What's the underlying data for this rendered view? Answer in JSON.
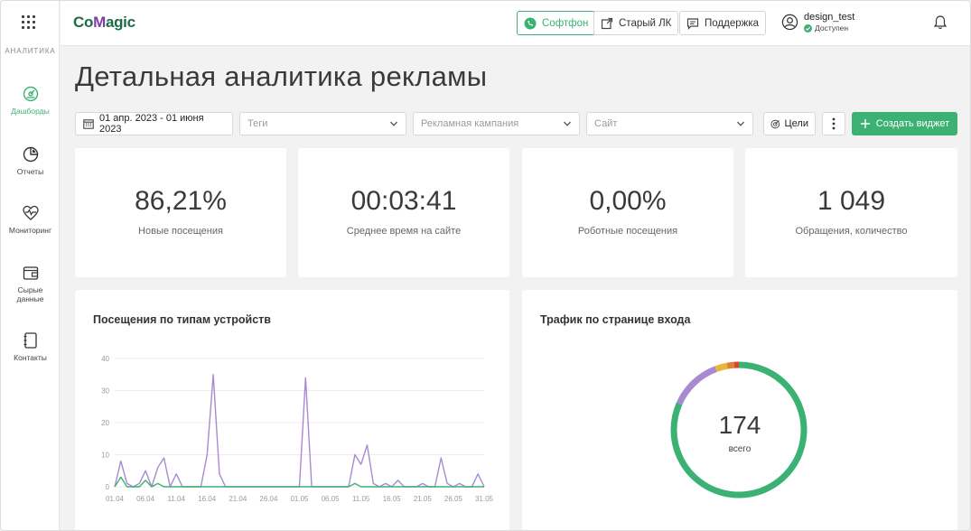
{
  "sidebar": {
    "section": "АНАЛИТИКА",
    "items": [
      {
        "label": "Дашборды",
        "icon": "dashboard-icon"
      },
      {
        "label": "Отчеты",
        "icon": "pie-chart-icon"
      },
      {
        "label": "Мониторинг",
        "icon": "heart-pulse-icon"
      },
      {
        "label": "Сырые данные",
        "icon": "wallet-icon"
      },
      {
        "label": "Контакты",
        "icon": "contacts-book-icon"
      }
    ]
  },
  "topbar": {
    "logo_a": "Co",
    "logo_b": "M",
    "logo_c": "agic",
    "softphone": "Софтфон",
    "old_lk": "Старый ЛК",
    "support": "Поддержка",
    "username": "design_test",
    "status": "Доступен"
  },
  "page": {
    "title": "Детальная аналитика рекламы"
  },
  "filters": {
    "date_range": "01 апр. 2023 - 01 июня 2023",
    "tags_placeholder": "Теги",
    "campaign_placeholder": "Рекламная кампания",
    "site_placeholder": "Сайт",
    "goals": "Цели",
    "create_widget": "Создать виджет"
  },
  "kpis": [
    {
      "value": "86,21%",
      "label": "Новые посещения"
    },
    {
      "value": "00:03:41",
      "label": "Среднее время на сайте"
    },
    {
      "value": "0,00%",
      "label": "Роботные посещения"
    },
    {
      "value": "1 049",
      "label": "Обращения, количество"
    }
  ],
  "colors": {
    "accent": "#3bb273",
    "purple": "#a98ad1",
    "orange": "#e8a33d",
    "red": "#d9452b"
  },
  "chart_data": [
    {
      "type": "line",
      "title": "Посещения по типам устройств",
      "x": [
        "01.04",
        "02.04",
        "03.04",
        "04.04",
        "05.04",
        "06.04",
        "07.04",
        "08.04",
        "09.04",
        "10.04",
        "11.04",
        "12.04",
        "13.04",
        "14.04",
        "15.04",
        "16.04",
        "17.04",
        "18.04",
        "19.04",
        "20.04",
        "21.04",
        "22.04",
        "23.04",
        "24.04",
        "25.04",
        "26.04",
        "27.04",
        "28.04",
        "29.04",
        "30.04",
        "01.05",
        "02.05",
        "03.05",
        "04.05",
        "05.05",
        "06.05",
        "07.05",
        "08.05",
        "09.05",
        "10.05",
        "11.05",
        "12.05",
        "13.05",
        "14.05",
        "15.05",
        "16.05",
        "17.05",
        "18.05",
        "19.05",
        "20.05",
        "21.05",
        "22.05",
        "23.05",
        "24.05",
        "25.05",
        "26.05",
        "27.05",
        "28.05",
        "29.05",
        "30.05",
        "31.05"
      ],
      "x_ticks": [
        "01.04",
        "06.04",
        "11.04",
        "16.04",
        "21.04",
        "26.04",
        "01.05",
        "06.05",
        "11.05",
        "16.05",
        "21.05",
        "26.05",
        "31.05"
      ],
      "y_ticks": [
        0,
        10,
        20,
        30,
        40
      ],
      "ylim": [
        0,
        40
      ],
      "grid": true,
      "series": [
        {
          "color": "#a98ad1",
          "values": [
            0,
            8,
            1,
            0,
            1,
            5,
            0,
            6,
            9,
            0,
            4,
            0,
            0,
            0,
            0,
            10,
            35,
            4,
            0,
            0,
            0,
            0,
            0,
            0,
            0,
            0,
            0,
            0,
            0,
            0,
            0,
            34,
            0,
            0,
            0,
            0,
            0,
            0,
            0,
            10,
            7,
            13,
            1,
            0,
            1,
            0,
            2,
            0,
            0,
            0,
            1,
            0,
            0,
            9,
            1,
            0,
            1,
            0,
            0,
            4,
            0
          ]
        },
        {
          "color": "#3bb273",
          "values": [
            0,
            3,
            0,
            0,
            0,
            2,
            0,
            1,
            0,
            0,
            0,
            0,
            0,
            0,
            0,
            0,
            0,
            0,
            0,
            0,
            0,
            0,
            0,
            0,
            0,
            0,
            0,
            0,
            0,
            0,
            0,
            0,
            0,
            0,
            0,
            0,
            0,
            0,
            0,
            1,
            0,
            0,
            0,
            0,
            0,
            0,
            0,
            0,
            0,
            0,
            0,
            0,
            0,
            0,
            0,
            0,
            0,
            0,
            0,
            0,
            0
          ]
        }
      ]
    },
    {
      "type": "pie",
      "title": "Трафик по странице входа",
      "total": "174",
      "total_label": "всего",
      "slices": [
        {
          "value": 142,
          "color": "#3bb273"
        },
        {
          "value": 22,
          "color": "#a98ad1"
        },
        {
          "value": 5,
          "color": "#e8b53d"
        },
        {
          "value": 3,
          "color": "#e07f3a"
        },
        {
          "value": 2,
          "color": "#d9452b"
        }
      ]
    }
  ]
}
